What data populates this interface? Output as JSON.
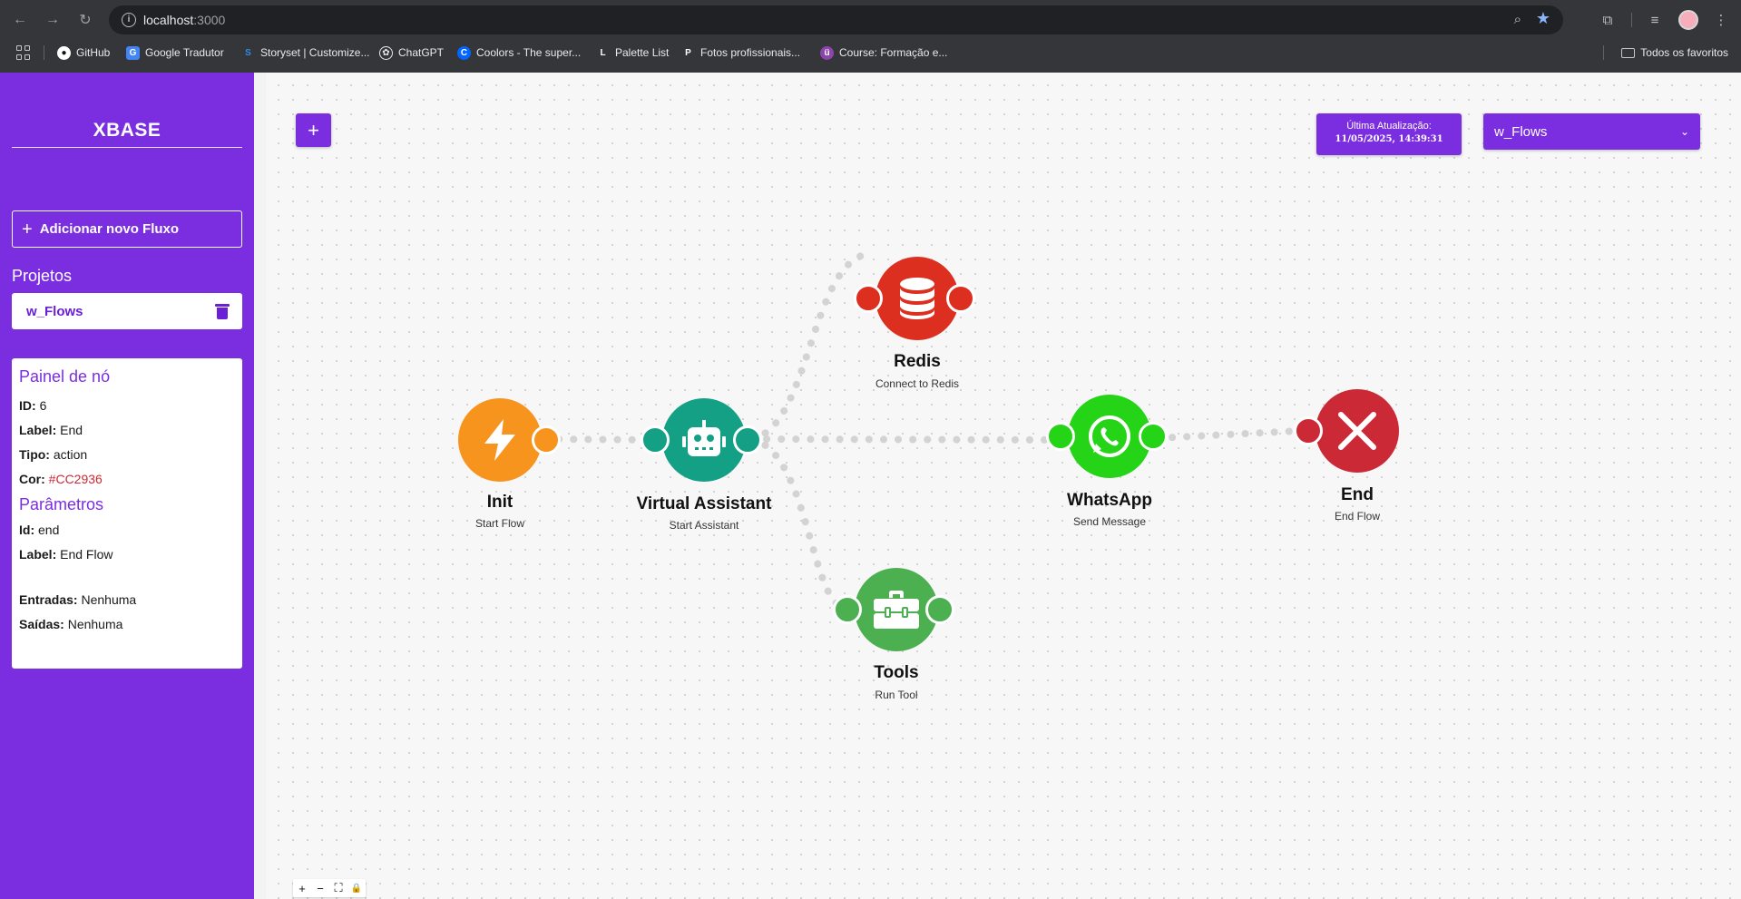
{
  "browser": {
    "url_host": "localhost",
    "url_port": ":3000",
    "bookmarks": [
      {
        "label": "GitHub",
        "icon": "github-icon",
        "color": "#ffffff"
      },
      {
        "label": "Google Tradutor",
        "icon": "google-translate-icon",
        "color": "#4285f4"
      },
      {
        "label": "Storyset | Customize...",
        "icon": "storyset-icon",
        "color": "#2d8cf0"
      },
      {
        "label": "ChatGPT",
        "icon": "chatgpt-icon",
        "color": "#e8eaed"
      },
      {
        "label": "Coolors - The super...",
        "icon": "coolors-icon",
        "color": "#0066ff"
      },
      {
        "label": "Palette List",
        "icon": "palette-list-icon",
        "color": "#ffffff"
      },
      {
        "label": "Fotos profissionais...",
        "icon": "pexels-icon",
        "color": "#ffffff"
      },
      {
        "label": "Course: Formação e...",
        "icon": "course-icon",
        "color": "#8e44ad"
      }
    ],
    "all_bookmarks_label": "Todos os favoritos"
  },
  "sidebar": {
    "brand": "XBASE",
    "add_flow_label": "Adicionar novo Fluxo",
    "projects_title": "Projetos",
    "projects": [
      {
        "name": "w_Flows"
      }
    ]
  },
  "node_panel": {
    "title": "Painel de nó",
    "id_label": "ID:",
    "id_value": "6",
    "label_label": "Label:",
    "label_value": "End",
    "type_label": "Tipo:",
    "type_value": "action",
    "color_label": "Cor:",
    "color_value": "#CC2936",
    "params_title": "Parâmetros",
    "param_id_label": "Id:",
    "param_id_value": "end",
    "param_label_label": "Label:",
    "param_label_value": "End Flow",
    "inputs_label": "Entradas:",
    "inputs_value": "Nenhuma",
    "outputs_label": "Saídas:",
    "outputs_value": "Nenhuma"
  },
  "toolbar": {
    "add_label": "+",
    "last_update_label": "Última Atualização:",
    "last_update_time": "11/05/2025, 14:39:31",
    "selected_flow": "w_Flows"
  },
  "nodes": [
    {
      "id": "init",
      "label": "Init",
      "sub": "Start Flow",
      "color": "#f7941d",
      "icon": "lightning-icon"
    },
    {
      "id": "assistant",
      "label": "Virtual Assistant",
      "sub": "Start Assistant",
      "color": "#14a085",
      "icon": "robot-icon"
    },
    {
      "id": "redis",
      "label": "Redis",
      "sub": "Connect to Redis",
      "color": "#dc2f1f",
      "icon": "database-icon"
    },
    {
      "id": "whatsapp",
      "label": "WhatsApp",
      "sub": "Send Message",
      "color": "#25d317",
      "icon": "whatsapp-icon"
    },
    {
      "id": "end",
      "label": "End",
      "sub": "End Flow",
      "color": "#cc2936",
      "icon": "close-icon"
    },
    {
      "id": "tools",
      "label": "Tools",
      "sub": "Run Tool",
      "color": "#4caf50",
      "icon": "toolbox-icon"
    }
  ],
  "controls": [
    "+",
    "−",
    "⛶",
    "🔒"
  ],
  "colors": {
    "accent": "#7b2ee0",
    "edge": "#d3d3d3"
  }
}
